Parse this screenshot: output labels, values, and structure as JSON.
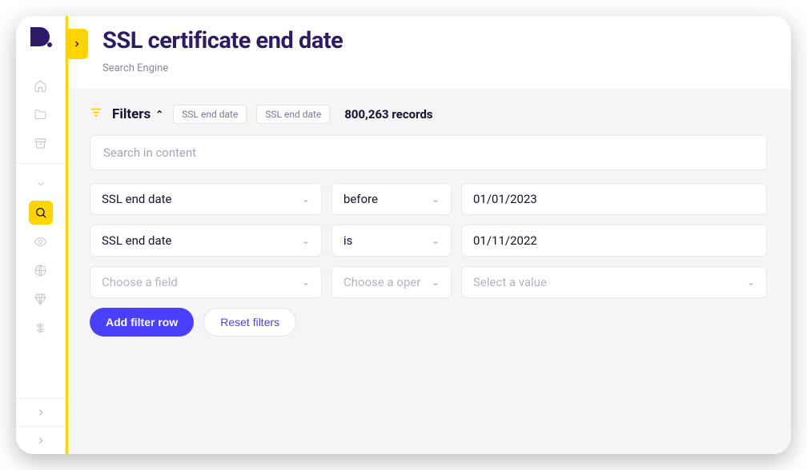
{
  "header": {
    "title": "SSL certificate end date",
    "subtitle": "Search Engine"
  },
  "filters": {
    "label": "Filters",
    "chips": [
      "SSL end date",
      "SSL end date"
    ],
    "records": "800,263 records",
    "search_placeholder": "Search in content",
    "rows": [
      {
        "field": "SSL end date",
        "op": "before",
        "value": "01/01/2023",
        "placeholder": false
      },
      {
        "field": "SSL end date",
        "op": "is",
        "value": "01/11/2022",
        "placeholder": false
      },
      {
        "field": "Choose a field",
        "op": "Choose a oper",
        "value": "Select a value",
        "placeholder": true
      }
    ],
    "add_label": "Add filter row",
    "reset_label": "Reset filters"
  }
}
